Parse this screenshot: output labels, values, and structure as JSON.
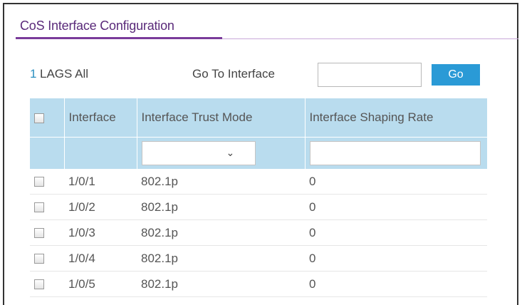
{
  "panel": {
    "title": "CoS Interface Configuration"
  },
  "toolbar": {
    "lags_count": "1",
    "lags_label": "LAGS All",
    "goto_label": "Go To Interface",
    "goto_value": "",
    "go_button_label": "Go"
  },
  "table": {
    "headers": {
      "interface": "Interface",
      "trust_mode": "Interface Trust Mode",
      "shaping_rate": "Interface Shaping Rate"
    },
    "filter": {
      "trust_mode_selected": "",
      "shaping_rate_value": ""
    },
    "rows": [
      {
        "interface": "1/0/1",
        "trust_mode": "802.1p",
        "shaping_rate": "0"
      },
      {
        "interface": "1/0/2",
        "trust_mode": "802.1p",
        "shaping_rate": "0"
      },
      {
        "interface": "1/0/3",
        "trust_mode": "802.1p",
        "shaping_rate": "0"
      },
      {
        "interface": "1/0/4",
        "trust_mode": "802.1p",
        "shaping_rate": "0"
      },
      {
        "interface": "1/0/5",
        "trust_mode": "802.1p",
        "shaping_rate": "0"
      }
    ]
  },
  "icons": {
    "dropdown": "chevron-down-icon"
  },
  "colors": {
    "title": "#5a2a7a",
    "title_rule": "#7a3b9a",
    "accent_link": "#2a8fc0",
    "go_button": "#2a9ad6",
    "table_header_bg": "#b9dcee"
  }
}
